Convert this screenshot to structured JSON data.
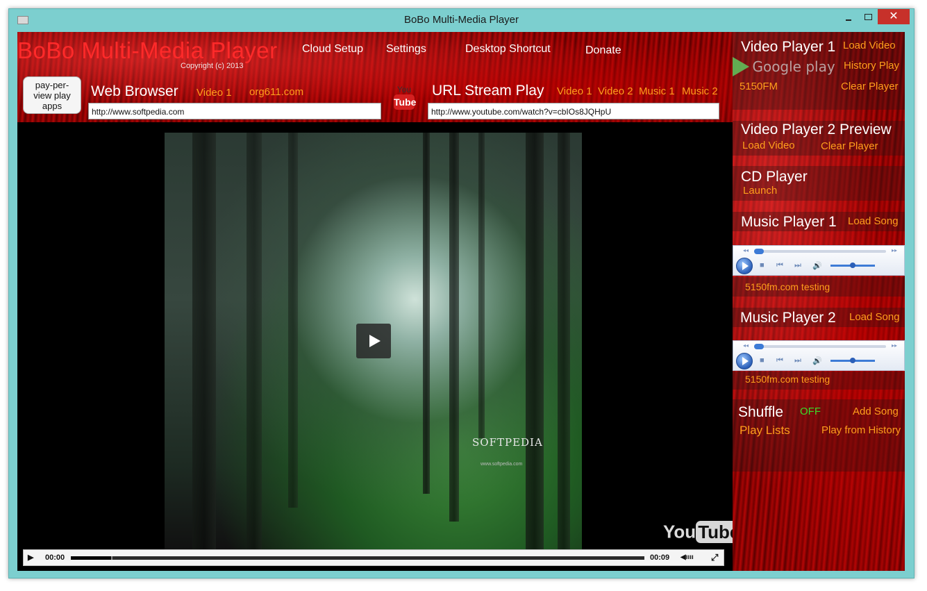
{
  "window": {
    "title": "BoBo Multi-Media Player",
    "close_glyph": "✕"
  },
  "header": {
    "app_title": "BoBo Multi-Media Player",
    "copyright": "Copyright (c) 2013",
    "menu": {
      "cloud_setup": "Cloud Setup",
      "settings": "Settings",
      "desktop_shortcut": "Desktop Shortcut",
      "donate": "Donate"
    },
    "ppv_button": "pay-per-view play apps",
    "web_browser": {
      "label": "Web Browser",
      "video1": "Video 1",
      "site_link": "org611.com",
      "url": "http://www.softpedia.com"
    },
    "youtube_badge": {
      "you": "You",
      "tube": "Tube"
    },
    "url_stream": {
      "label": "URL Stream Play",
      "video1": "Video 1",
      "video2": "Video 2",
      "music1": "Music 1",
      "music2": "Music 2",
      "url": "http://www.youtube.com/watch?v=cbIOs8JQHpU"
    }
  },
  "video": {
    "watermark": "SOFTPEDIA",
    "watermark_url": "www.softpedia.com",
    "yt_you": "You",
    "yt_tube": "Tube",
    "controls": {
      "time_current": "00:00",
      "time_total": "00:09",
      "progress_fraction": 0.07
    }
  },
  "sidebar": {
    "video_player1": {
      "title": "Video Player 1",
      "load_video": "Load Video",
      "google_play": "Google play",
      "history_play": "History Play",
      "station": "5150FM",
      "clear_player": "Clear Player"
    },
    "video_player2": {
      "title": "Video Player 2 Preview",
      "load_video": "Load Video",
      "clear_player": "Clear Player"
    },
    "cd_player": {
      "title": "CD Player",
      "launch": "Launch"
    },
    "music_player1": {
      "title": "Music Player 1",
      "load_song": "Load Song",
      "now_playing": "5150fm.com testing"
    },
    "music_player2": {
      "title": "Music Player 2",
      "load_song": "Load Song",
      "now_playing": "5150fm.com testing"
    },
    "shuffle": {
      "title": "Shuffle",
      "state": "OFF",
      "add_song": "Add Song",
      "play_lists": "Play Lists",
      "play_from_history": "Play from History"
    }
  },
  "colors": {
    "accent_orange": "#ff9f1c",
    "shuffle_state": "#3adc2a",
    "title_red": "#ff2a2a",
    "frame": "#7ccfcf"
  }
}
